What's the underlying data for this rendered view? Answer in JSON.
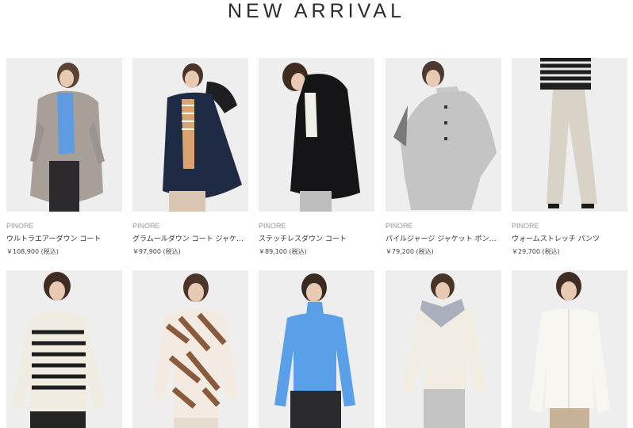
{
  "section": {
    "title": "NEW ARRIVAL"
  },
  "products": [
    {
      "brand": "PINORE",
      "name": "ウルトラエアーダウン コート",
      "price": "￥108,900 (税込)",
      "image": "model-in-taupe-down-coat-blue-turtleneck"
    },
    {
      "brand": "PINORE",
      "name": "グラムールダウン コート ジャケット",
      "price": "￥97,900 (税込)",
      "image": "model-in-navy-down-jacket-fur-hood"
    },
    {
      "brand": "PINORE",
      "name": "ステッチレスダウン コート",
      "price": "￥89,100 (税込)",
      "image": "model-in-black-hooded-down-coat"
    },
    {
      "brand": "PINORE",
      "name": "パイルジャージ ジャケット ポンチョ",
      "price": "￥79,200 (税込)",
      "image": "model-in-grey-cape-jacket"
    },
    {
      "brand": "PINORE",
      "name": "ウォームストレッチ パンツ",
      "price": "￥29,700 (税込)",
      "image": "model-in-beige-wide-pants"
    },
    {
      "image": "model-in-ivory-striped-knit"
    },
    {
      "image": "model-in-zebra-pattern-knit"
    },
    {
      "image": "model-in-blue-turtleneck-knit"
    },
    {
      "image": "model-in-ivory-knit-vest-grey-collar"
    },
    {
      "image": "model-in-ivory-blouse"
    }
  ],
  "colors": {
    "title": "#2b2b2b",
    "brand": "#9a9a9a",
    "text": "#333333",
    "photo_bg": "#efefef"
  }
}
